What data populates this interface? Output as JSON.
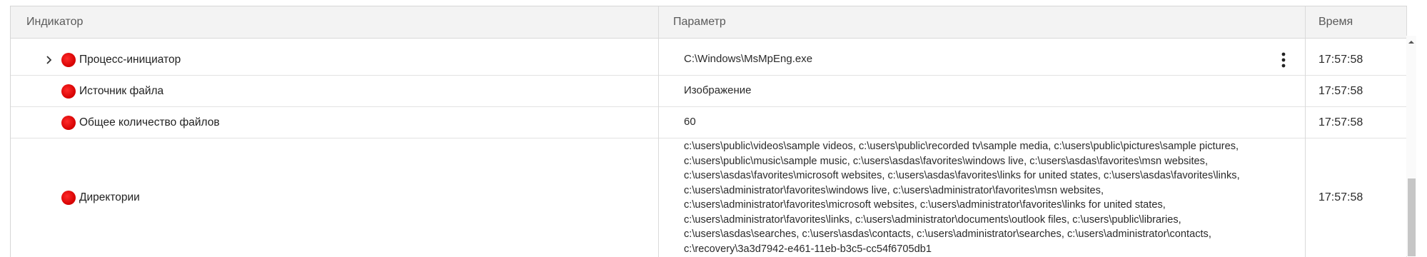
{
  "table": {
    "columns": [
      "Индикатор",
      "Параметр",
      "Время"
    ],
    "rows": [
      {
        "indicator": "Процесс-инициатор",
        "expandable": true,
        "status_color": "#e00000",
        "parameter": "C:\\Windows\\MsMpEng.exe",
        "has_menu": true,
        "time": "17:57:58"
      },
      {
        "indicator": "Источник файла",
        "expandable": false,
        "status_color": "#e00000",
        "parameter": "Изображение",
        "has_menu": false,
        "time": "17:57:58"
      },
      {
        "indicator": "Общее количество файлов",
        "expandable": false,
        "status_color": "#e00000",
        "parameter": "60",
        "has_menu": false,
        "time": "17:57:58"
      },
      {
        "indicator": "Директории",
        "expandable": false,
        "status_color": "#e00000",
        "parameter": "c:\\users\\public\\videos\\sample videos, c:\\users\\public\\recorded tv\\sample media, c:\\users\\public\\pictures\\sample pictures, c:\\users\\public\\music\\sample music, c:\\users\\asdas\\favorites\\windows live, c:\\users\\asdas\\favorites\\msn websites, c:\\users\\asdas\\favorites\\microsoft websites, c:\\users\\asdas\\favorites\\links for united states, c:\\users\\asdas\\favorites\\links, c:\\users\\administrator\\favorites\\windows live, c:\\users\\administrator\\favorites\\msn websites, c:\\users\\administrator\\favorites\\microsoft websites, c:\\users\\administrator\\favorites\\links for united states, c:\\users\\administrator\\favorites\\links, c:\\users\\administrator\\documents\\outlook files, c:\\users\\public\\libraries, c:\\users\\asdas\\searches, c:\\users\\asdas\\contacts, c:\\users\\administrator\\searches, c:\\users\\administrator\\contacts, c:\\recovery\\3a3d7942-e461-11eb-b3c5-cc54f6705db1",
        "has_menu": false,
        "time": "17:57:58"
      }
    ]
  },
  "icons": {
    "expand": "chevron-right-icon",
    "status": "status-dot-icon",
    "menu": "more-vertical-icon",
    "scroll_up": "arrow-up-icon"
  }
}
